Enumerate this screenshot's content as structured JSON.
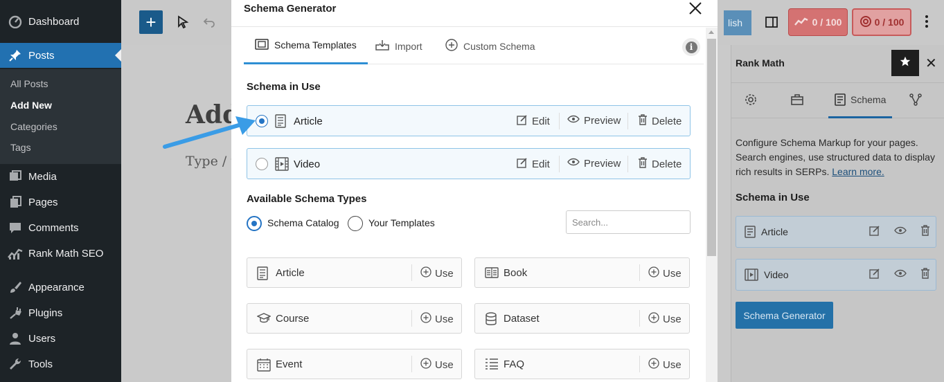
{
  "sidebar": {
    "items": [
      {
        "label": "Dashboard",
        "icon": "dashboard-icon"
      },
      {
        "label": "Posts",
        "icon": "pin-icon"
      },
      {
        "label": "Media",
        "icon": "media-icon"
      },
      {
        "label": "Pages",
        "icon": "pages-icon"
      },
      {
        "label": "Comments",
        "icon": "comments-icon"
      },
      {
        "label": "Rank Math SEO",
        "icon": "rankmath-icon"
      },
      {
        "label": "Appearance",
        "icon": "brush-icon"
      },
      {
        "label": "Plugins",
        "icon": "plugin-icon"
      },
      {
        "label": "Users",
        "icon": "users-icon"
      },
      {
        "label": "Tools",
        "icon": "tools-icon"
      }
    ],
    "submenu": [
      "All Posts",
      "Add New",
      "Categories",
      "Tags"
    ]
  },
  "editor": {
    "title_placeholder": "Add",
    "body_placeholder": "Type / t",
    "publish_partial": "lish",
    "seo_score": "0 / 100",
    "content_score": "0 / 100"
  },
  "right_panel": {
    "title": "Rank Math",
    "tabs": {
      "schema": "Schema"
    },
    "description": "Configure Schema Markup for your pages. Search engines, use structured data to display rich results in SERPs.",
    "learn_more": "Learn more.",
    "schema_in_use_heading": "Schema in Use",
    "schemas": [
      "Article",
      "Video"
    ],
    "generator_button": "Schema Generator"
  },
  "modal": {
    "title": "Schema Generator",
    "tabs": [
      "Schema Templates",
      "Import",
      "Custom Schema"
    ],
    "in_use_heading": "Schema in Use",
    "in_use": [
      {
        "name": "Article",
        "selected": true
      },
      {
        "name": "Video",
        "selected": false
      }
    ],
    "actions": {
      "edit": "Edit",
      "preview": "Preview",
      "delete": "Delete"
    },
    "available_heading": "Available Schema Types",
    "source_options": {
      "catalog": "Schema Catalog",
      "templates": "Your Templates"
    },
    "search_placeholder": "Search...",
    "use_label": "Use",
    "types": [
      "Article",
      "Book",
      "Course",
      "Dataset",
      "Event",
      "FAQ"
    ]
  },
  "colors": {
    "wp_dark": "#1d2327",
    "wp_blue": "#2271b1",
    "accent": "#2474c4",
    "annotation_arrow": "#3a9ce6"
  }
}
